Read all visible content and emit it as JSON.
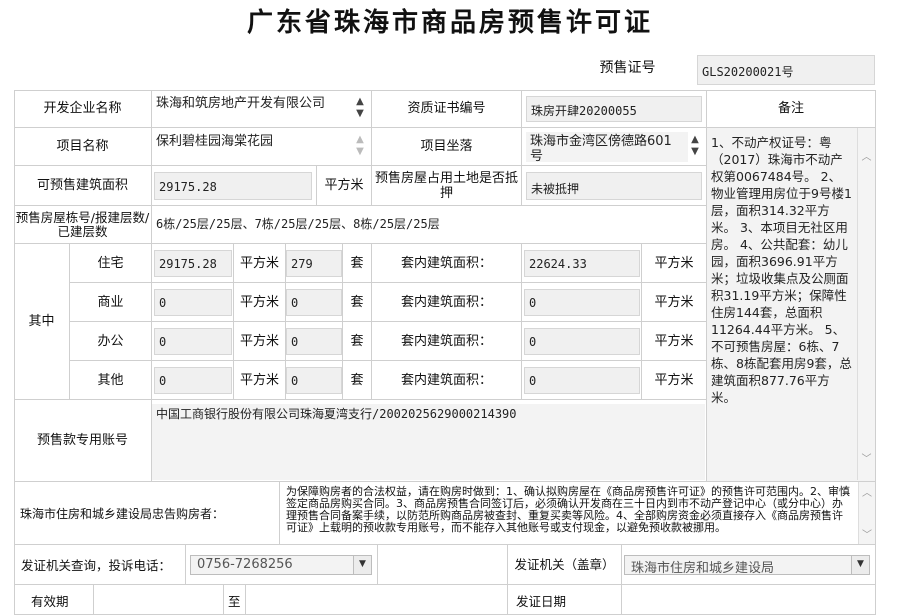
{
  "title": "广东省珠海市商品房预售许可证",
  "permit": {
    "label": "预售证号",
    "value": "GLS20200021号"
  },
  "labels": {
    "developer": "开发企业名称",
    "cert_no": "资质证书编号",
    "remarks": "备注",
    "project_name": "项目名称",
    "location": "项目坐落",
    "sellable_area": "可预售建筑面积",
    "unit_sqm": "平方米",
    "land_mortgage": "预售房屋占用土地是否抵押",
    "building_floors": "预售房屋栋号/报建层数/已建层数",
    "among": "其中",
    "unit_set": "套",
    "inner_area": "套内建筑面积：",
    "escrow_account": "预售款专用账号",
    "notice_authority": "珠海市住房和城乡建设局忠告购房者：",
    "hotline": "发证机关查询，投诉电话：",
    "issuer": "发证机关（盖章）"
  },
  "values": {
    "developer": "珠海和筑房地产开发有限公司",
    "cert_no": "珠房开肆20200055",
    "project_name": "保利碧桂园海棠花园",
    "location": "珠海市金湾区傍德路601号",
    "sellable_area": "29175.28",
    "land_mortgage": "未被抵押",
    "building_floors": "6栋/25层/25层、7栋/25层/25层、8栋/25层/25层",
    "escrow_account": "中国工商银行股份有限公司珠海夏湾支行/2002025629000214390",
    "hotline": "0756-7268256",
    "issuer": "珠海市住房和城乡建设局"
  },
  "remarks_text": "1、不动产权证号：粤（2017）珠海市不动产权第0067484号。 2、物业管理用房位于9号楼1层，面积314.32平方米。 3、本项目无社区用房。 4、公共配套：幼儿园，面积3696.91平方米；垃圾收集点及公厕面积31.19平方米；保障性住房144套，总面积11264.44平方米。 5、不可预售房屋：6栋、7栋、8栋配套用房9套，总建筑面积877.76平方米。",
  "notice_text": "为保障购房者的合法权益，请在购房时做到：1、确认拟购房屋在《商品房预售许可证》的预售许可范围内。2、审慎签定商品房购买合同。3、商品房预售合同签订后，必须确认开发商在三十日内到市不动产登记中心（或分中心）办理预售合同备案手续，以防范所购商品房被查封、重复买卖等风险。4、全部购房资金必须直接存入《商品房预售许可证》上载明的预收款专用账号，而不能存入其他账号或支付现金，以避免预收款被挪用。",
  "usage_rows": [
    {
      "type": "住宅",
      "area": "29175.28",
      "units": "279",
      "inner": "22624.33"
    },
    {
      "type": "商业",
      "area": "0",
      "units": "0",
      "inner": "0"
    },
    {
      "type": "办公",
      "area": "0",
      "units": "0",
      "inner": "0"
    },
    {
      "type": "其他",
      "area": "0",
      "units": "0",
      "inner": "0"
    }
  ],
  "bottom_row": {
    "left_label": "有效期",
    "mid_label": "至",
    "right_label": "发证日期"
  }
}
